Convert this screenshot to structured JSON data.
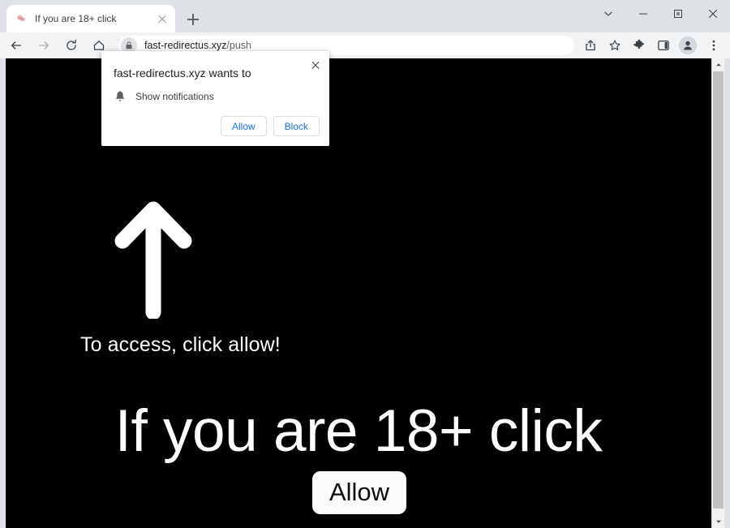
{
  "window": {
    "controls": [
      {
        "name": "tab-search-button",
        "icon": "chevron-down-icon",
        "label": "Search tabs"
      },
      {
        "name": "minimize-button",
        "icon": "minimize-icon",
        "label": "Minimize"
      },
      {
        "name": "maximize-button",
        "icon": "maximize-icon",
        "label": "Maximize"
      },
      {
        "name": "close-button",
        "icon": "close-icon",
        "label": "Close"
      }
    ]
  },
  "tab_strip": {
    "tab": {
      "title": "If you are 18+ click",
      "favicon": "site-favicon",
      "close_label": "Close tab"
    },
    "new_tab_label": "New tab"
  },
  "toolbar": {
    "back_label": "Back",
    "forward_label": "Forward",
    "reload_label": "Reload this page",
    "home_label": "Home",
    "omnibox": {
      "site_info_icon": "lock-icon",
      "url_host": "fast-redirectus.xyz",
      "url_path": "/push",
      "full_url": "fast-redirectus.xyz/push"
    },
    "actions": [
      {
        "name": "share-button",
        "icon": "share-icon",
        "label": "Share this page"
      },
      {
        "name": "bookmark-button",
        "icon": "star-icon",
        "label": "Bookmark this tab"
      },
      {
        "name": "extensions-button",
        "icon": "puzzle-icon",
        "label": "Extensions"
      },
      {
        "name": "side-panel-button",
        "icon": "side-panel-icon",
        "label": "Side panel"
      },
      {
        "name": "profile-button",
        "icon": "person-icon",
        "label": "Profile"
      },
      {
        "name": "menu-button",
        "icon": "three-dots-icon",
        "label": "Customize and control Google Chrome"
      }
    ]
  },
  "permission_dialog": {
    "title": "fast-redirectus.xyz wants to",
    "permission_icon": "bell-icon",
    "permission_label": "Show notifications",
    "allow_label": "Allow",
    "block_label": "Block",
    "close_label": "Close"
  },
  "page": {
    "background_color": "#000000",
    "arrow_icon": "arrow-up-icon",
    "instruction_text": "To access, click allow!",
    "headline": "If you are 18+ click",
    "cta_button_label": "Allow",
    "text_color": "#ffffff"
  },
  "scrollbar": {
    "up_label": "Scroll up",
    "down_label": "Scroll down",
    "thumb_label": "Scroll thumb"
  }
}
